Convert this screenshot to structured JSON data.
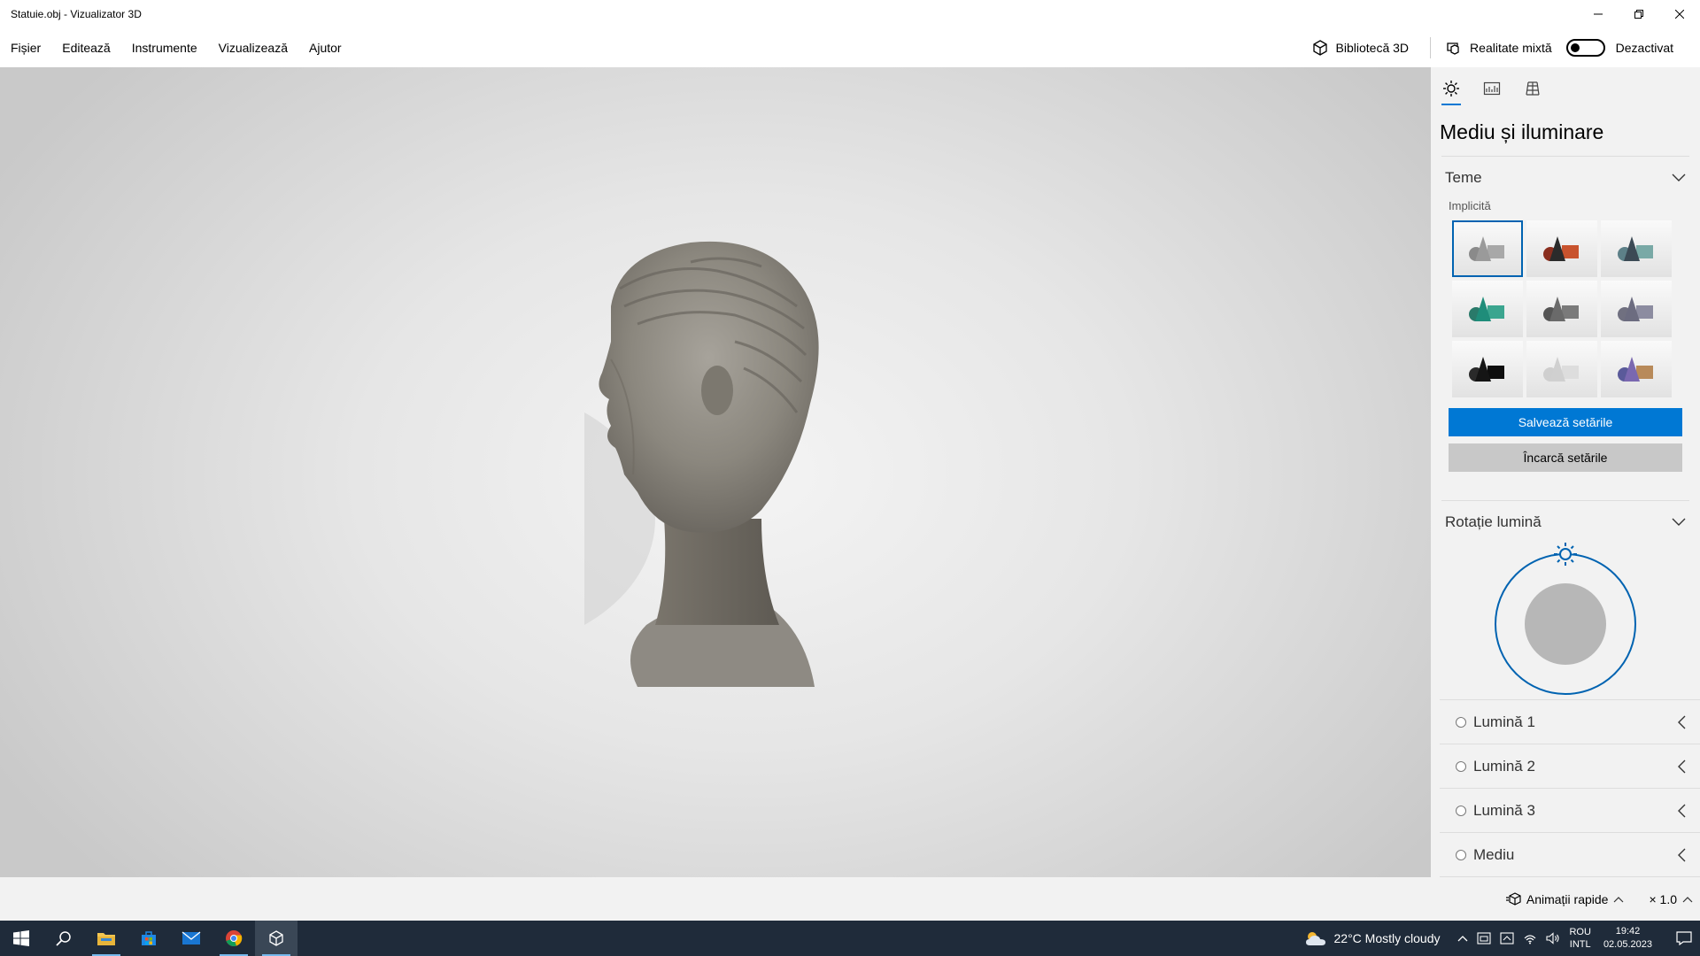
{
  "window": {
    "title": "Statuie.obj - Vizualizator 3D"
  },
  "menu": {
    "items": [
      "Fișier",
      "Editează",
      "Instrumente",
      "Vizualizează",
      "Ajutor"
    ],
    "library_label": "Bibliotecă 3D",
    "mixed_reality_label": "Realitate mixtă",
    "mixed_reality_state": "Dezactivat"
  },
  "panel": {
    "title": "Mediu și iluminare",
    "themes_section": "Teme",
    "themes_sublabel": "Implicită",
    "save_button": "Salvează setările",
    "load_button": "Încarcă setările",
    "light_rotation_section": "Rotație lumină",
    "lights": [
      "Lumină 1",
      "Lumină 2",
      "Lumină 3",
      "Mediu"
    ],
    "themes": [
      {
        "cone": "#9a9a9a",
        "sphere": "#8a8a8a",
        "box": "#a8a8a8",
        "selected": true
      },
      {
        "cone": "#2b2b2b",
        "sphere": "#8a2e1e",
        "box": "#c8532e",
        "selected": false
      },
      {
        "cone": "#3c4a55",
        "sphere": "#5d8088",
        "box": "#79a9a6",
        "selected": false
      },
      {
        "cone": "#1f8d7a",
        "sphere": "#2a7a6a",
        "box": "#3ba58f",
        "selected": false
      },
      {
        "cone": "#6a6a6a",
        "sphere": "#555555",
        "box": "#7a7a7a",
        "selected": false
      },
      {
        "cone": "#6c6c80",
        "sphere": "#707080",
        "box": "#8c8ca0",
        "selected": false
      },
      {
        "cone": "#151515",
        "sphere": "#2a2a2a",
        "box": "#0e0e0e",
        "selected": false
      },
      {
        "cone": "#d0d0d0",
        "sphere": "#cfcfcf",
        "box": "#dddddd",
        "selected": false
      },
      {
        "cone": "#7a68b0",
        "sphere": "#5a5a9a",
        "box": "#b88a5a",
        "selected": false
      }
    ]
  },
  "statusbar": {
    "animations_label": "Animații rapide",
    "zoom": "× 1.0"
  },
  "taskbar": {
    "weather": "22°C  Mostly cloudy",
    "lang_line1": "ROU",
    "lang_line2": "INTL",
    "time": "19:42",
    "date": "02.05.2023"
  },
  "colors": {
    "accent": "#0078d4",
    "taskbar": "#1f2b3a"
  }
}
